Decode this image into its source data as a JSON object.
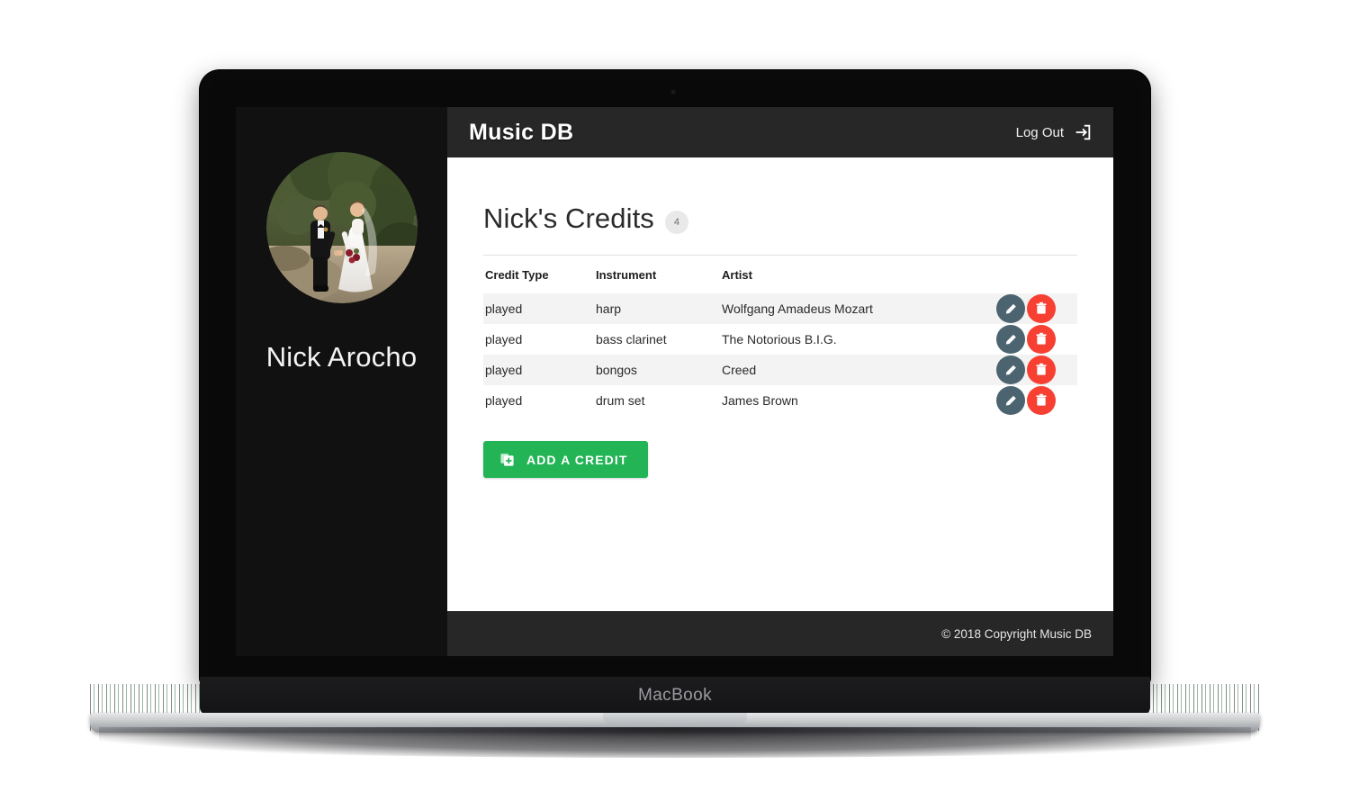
{
  "device": {
    "chassis_label": "MacBook"
  },
  "sidebar": {
    "profile_name": "Nick Arocho",
    "avatar_alt": "wedding-photo-couple-holding-hands"
  },
  "navbar": {
    "brand": "Music DB",
    "logout_label": "Log Out",
    "logout_icon": "sign-out-icon"
  },
  "page": {
    "title": "Nick's Credits",
    "count_badge": "4"
  },
  "table": {
    "columns": [
      "Credit Type",
      "Instrument",
      "Artist"
    ],
    "rows": [
      {
        "credit_type": "played",
        "instrument": "harp",
        "artist": "Wolfgang Amadeus Mozart"
      },
      {
        "credit_type": "played",
        "instrument": "bass clarinet",
        "artist": "The Notorious B.I.G."
      },
      {
        "credit_type": "played",
        "instrument": "bongos",
        "artist": "Creed"
      },
      {
        "credit_type": "played",
        "instrument": "drum set",
        "artist": "James Brown"
      }
    ],
    "edit_icon": "pencil-icon",
    "delete_icon": "trash-icon"
  },
  "actions": {
    "add_credit_label": "ADD A CREDIT",
    "add_credit_icon": "add-file-icon"
  },
  "footer": {
    "copyright": "© 2018 Copyright Music DB"
  },
  "colors": {
    "navbar": "#272727",
    "sidebar": "#111111",
    "add_button": "#22b455",
    "edit_button": "#4b6470",
    "delete_button": "#f73f32",
    "row_stripe": "#f3f3f3",
    "badge": "#e9e9e9"
  }
}
